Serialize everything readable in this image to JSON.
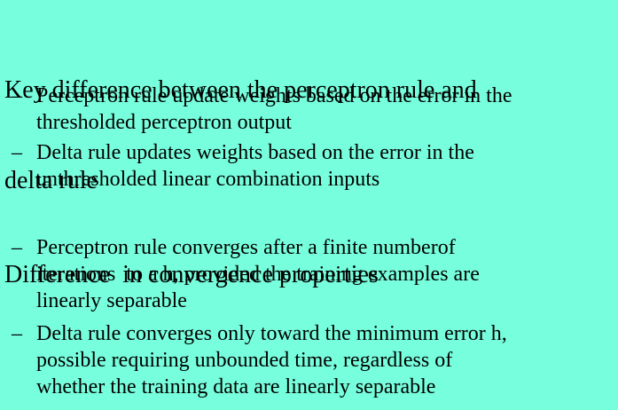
{
  "bullet_glyph": "–",
  "sections": [
    {
      "heading": [
        "Key difference between the perceptron rule and",
        "delta rule"
      ],
      "bullets": [
        [
          "Perceptron rule update weights based on the error in the",
          "thresholded perceptron output"
        ],
        [
          "Delta rule updates weights based on the error in the",
          "unthresholded linear combination inputs"
        ]
      ]
    },
    {
      "heading": [
        "Difference  in convergence properties"
      ],
      "bullets": [
        [
          "Perceptron rule converges after a finite numberof",
          "iterations  to a h, provided the training examples are",
          "linearly separable"
        ],
        [
          "Delta rule converges only toward the minimum error h,",
          "possible requiring unbounded time, regardless of",
          "whether the training data are linearly separable"
        ]
      ]
    }
  ],
  "colors": {
    "background": "#77ffdd",
    "text": "#000000"
  }
}
